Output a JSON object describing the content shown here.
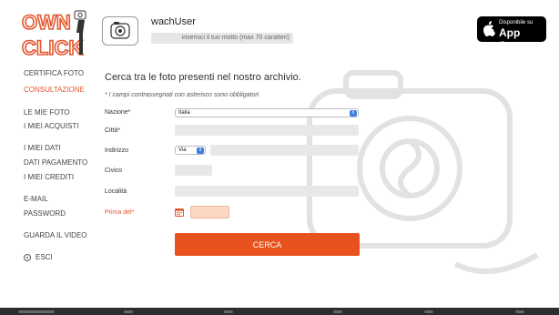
{
  "brand": {
    "line1": "OWN",
    "line2": "CLICK",
    "accent": "#e4572e"
  },
  "user": {
    "name": "wachUser",
    "motto_placeholder": "inserisci il tuo motto (max 70 caratteri)"
  },
  "appstore": {
    "line1": "Disponibile su",
    "line2": "App Store"
  },
  "sidebar": {
    "items": [
      {
        "label": "CERTIFICA FOTO",
        "active": false
      },
      {
        "label": "CONSULTAZIONE",
        "active": true
      },
      {
        "label": "LE MIE FOTO",
        "active": false
      },
      {
        "label": "I MIEI ACQUISTI",
        "active": false
      },
      {
        "label": "I MIEI DATI",
        "active": false
      },
      {
        "label": "DATI PAGAMENTO",
        "active": false
      },
      {
        "label": "I MIEI CREDITI",
        "active": false
      },
      {
        "label": "E-MAIL",
        "active": false
      },
      {
        "label": "PASSWORD",
        "active": false
      },
      {
        "label": "GUARDA IL VIDEO",
        "active": false
      },
      {
        "label": "ESCI",
        "active": false,
        "icon": "exit-icon"
      }
    ]
  },
  "form": {
    "heading": "Cerca tra le foto presenti nel nostro archivio.",
    "note": "* I campi contrassegnati con asterisco sono obbligatori",
    "nazione": {
      "label": "Nazione*",
      "value": "Italia"
    },
    "citta": {
      "label": "Città*"
    },
    "indirizzo": {
      "label": "Indirizzo",
      "type_value": "Via"
    },
    "civico": {
      "label": "Civico"
    },
    "localita": {
      "label": "Località"
    },
    "prima_del": {
      "label": "Prima del*"
    },
    "submit_label": "CERCA"
  }
}
